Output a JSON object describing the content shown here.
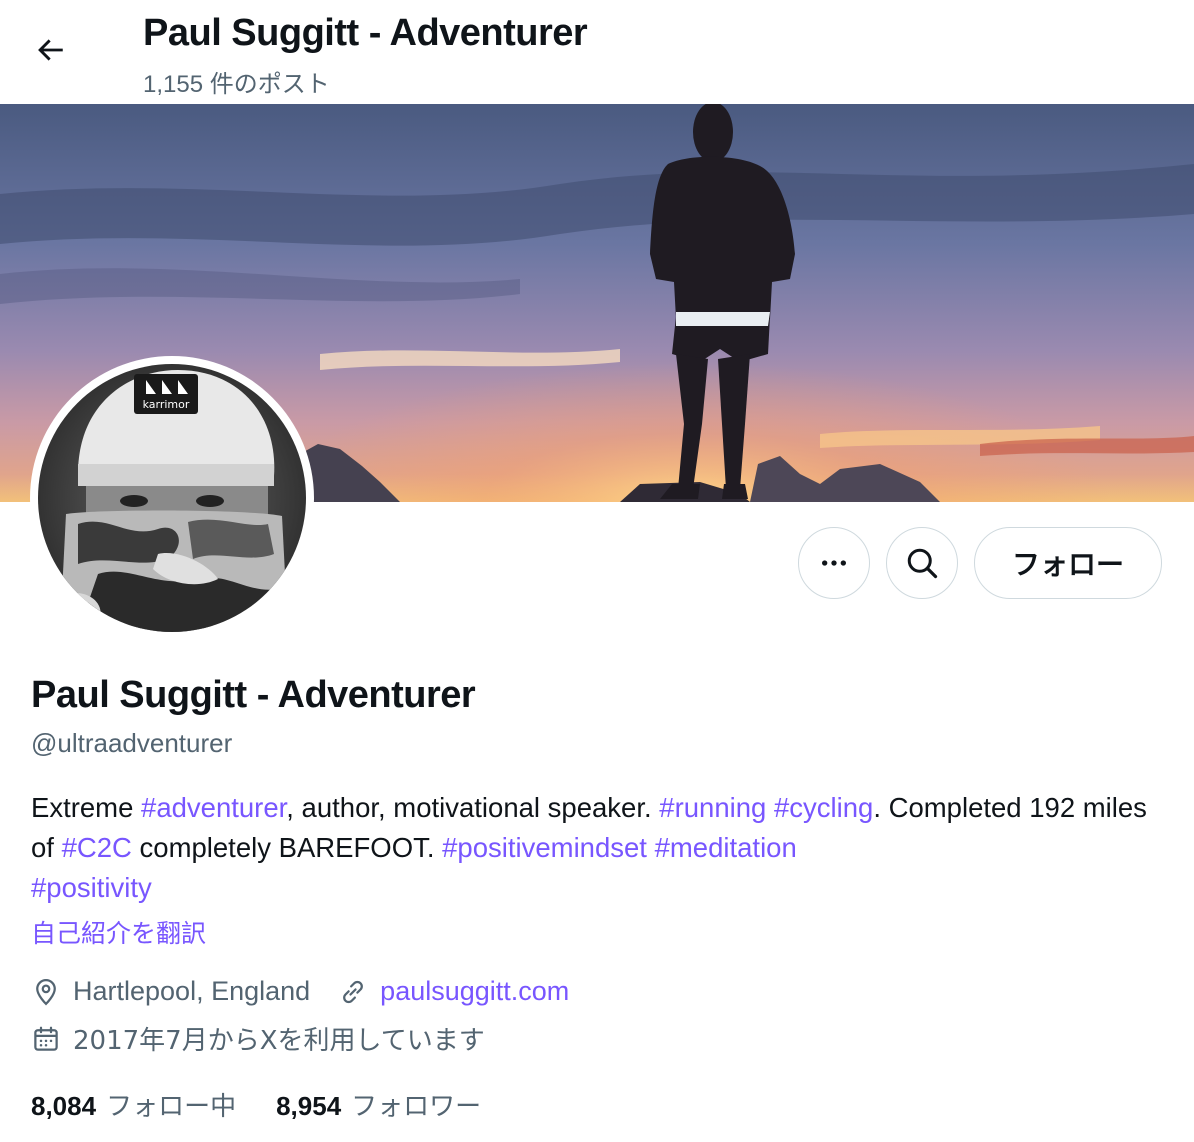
{
  "header": {
    "title": "Paul Suggitt - Adventurer",
    "post_count": "1,155 件のポスト",
    "back_icon": "arrow-left-icon"
  },
  "profile": {
    "display_name": "Paul Suggitt - Adventurer",
    "handle": "@ultraadventurer",
    "avatar_text": "karrimor",
    "bio": {
      "p1": "Extreme ",
      "tag1": "#adventurer",
      "p2": ", author, motivational speaker. ",
      "tag2": "#running",
      "p3": " ",
      "tag3": "#cycling",
      "p4": ". Completed 192 miles of ",
      "tag4": "#C2C",
      "p5": " completely BAREFOOT. ",
      "tag5": "#positivemindset",
      "p6": " ",
      "tag6": "#meditation",
      "p7": " ",
      "tag7": "#positivity"
    },
    "translate_label": "自己紹介を翻訳",
    "location": "Hartlepool, England",
    "website": "paulsuggitt.com",
    "joined": "2017年7月からXを利用しています",
    "following_count": "8,084",
    "following_label": "フォロー中",
    "followers_count": "8,954",
    "followers_label": "フォロワー"
  },
  "actions": {
    "more_icon": "more-horizontal-icon",
    "search_icon": "search-icon",
    "follow_label": "フォロー"
  },
  "colors": {
    "accent": "#7856ff",
    "text": "#0f1419",
    "muted": "#536471",
    "border": "#cfd9de"
  }
}
